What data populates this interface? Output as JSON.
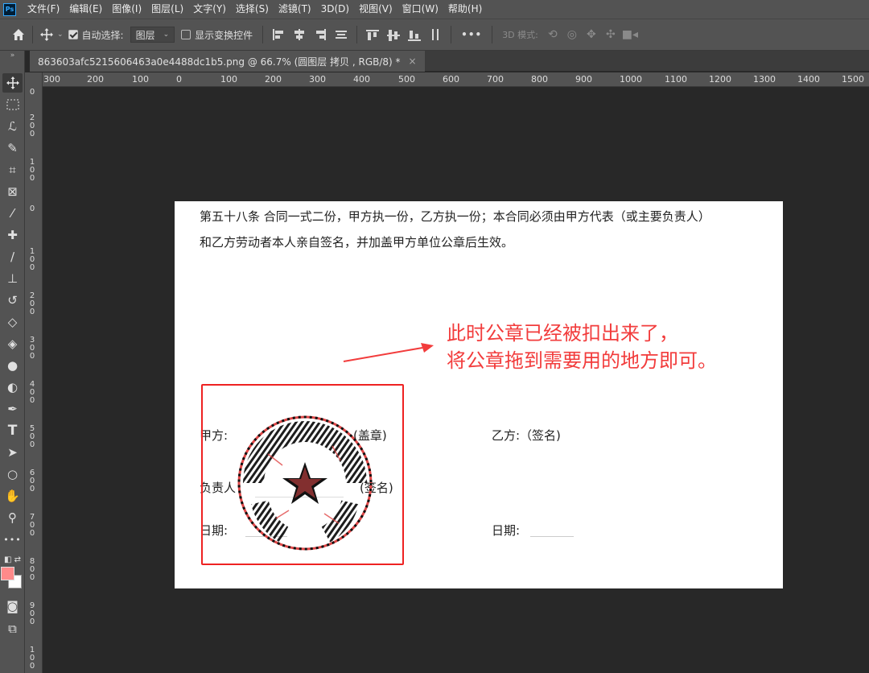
{
  "app": {
    "logo": "Ps",
    "accent": "#31a8ff"
  },
  "menu": [
    "文件(F)",
    "编辑(E)",
    "图像(I)",
    "图层(L)",
    "文字(Y)",
    "选择(S)",
    "滤镜(T)",
    "3D(D)",
    "视图(V)",
    "窗口(W)",
    "帮助(H)"
  ],
  "options": {
    "auto_select_label": "自动选择:",
    "auto_select_checked": true,
    "auto_select_value": "图层",
    "transform_label": "显示变换控件",
    "transform_checked": false,
    "more_label": "•••",
    "mode_3d_label": "3D 模式:"
  },
  "document_tab": {
    "title": "863603afc5215606463a0e4488dc1b5.png @ 66.7% (圆图层 拷贝 , RGB/8) *",
    "close": "×"
  },
  "tools": [
    "move-tool",
    "marquee-tool",
    "lasso-tool",
    "quick-select-tool",
    "crop-tool",
    "frame-tool",
    "eyedropper-tool",
    "healing-brush-tool",
    "brush-tool",
    "clone-stamp-tool",
    "history-brush-tool",
    "eraser-tool",
    "paint-bucket-tool",
    "blur-tool",
    "dodge-tool",
    "pen-tool",
    "type-tool",
    "path-select-tool",
    "ellipse-tool",
    "hand-tool",
    "zoom-tool",
    "edit-toolbar-tool"
  ],
  "colors": {
    "foreground": "#ff8a8a",
    "background": "#ffffff",
    "annotation": "#f23c3c",
    "highlight_box": "#ee2222"
  },
  "ruler_h": [
    "300",
    "200",
    "100",
    "0",
    "100",
    "200",
    "300",
    "400",
    "500",
    "600",
    "700",
    "800",
    "900",
    "1000",
    "1100",
    "1200",
    "1300",
    "1400",
    "1500"
  ],
  "ruler_v": [
    "0",
    "200",
    "100",
    "0",
    "100",
    "200",
    "300",
    "400",
    "500",
    "600",
    "700",
    "800",
    "900",
    "100"
  ],
  "doc": {
    "line1": "第五十八条  合同一式二份，甲方执一份，乙方执一份；本合同必须由甲方代表（或主要负责人）",
    "line2": "和乙方劳动者本人亲自签名，并加盖甲方单位公章后生效。",
    "annotation_line1": "此时公章已经被扣出来了，",
    "annotation_line2": "将公章拖到需要用的地方即可。",
    "party_a": "甲方:",
    "party_a_seal": "(盖章)",
    "party_b": "乙方:（签名)",
    "responsible": "负责人",
    "responsible_sign": "(签名)",
    "date_a": "日期:",
    "date_b": "日期:"
  }
}
